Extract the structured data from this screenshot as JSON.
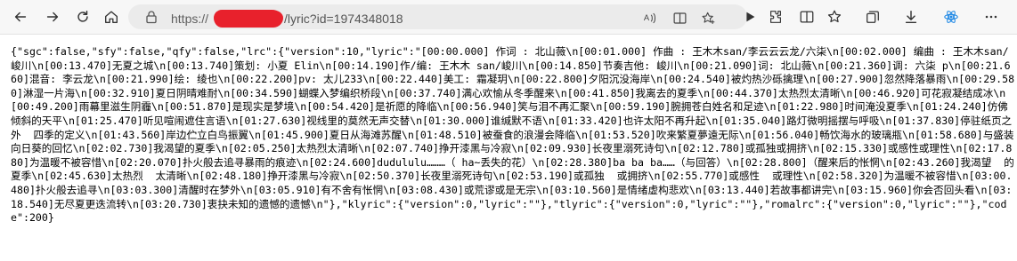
{
  "browser": {
    "url_prefix": "https://",
    "url_suffix": "/lyric?id=1974348018",
    "icons": [
      "back-icon",
      "forward-icon",
      "refresh-icon",
      "home-icon",
      "lock-icon",
      "read-aloud-icon",
      "split-screen-icon",
      "add-favorite-icon",
      "extension-icon",
      "play-icon",
      "split-icon",
      "favorites-icon",
      "collections-icon",
      "downloads-icon",
      "react-devtools-icon"
    ]
  },
  "page": {
    "json_text": "{\"sgc\":false,\"sfy\":false,\"qfy\":false,\"lrc\":{\"version\":10,\"lyric\":\"[00:00.000] 作词 : 北山薇\\n[00:01.000] 作曲 : 王木木san/李云云云龙/六柒\\n[00:02.000] 编曲 : 王木木san/峻川\\n[00:13.470]无夏之城\\n[00:13.740]策划: 小夏 Elin\\n[00:14.190]作/编: 王木木 san/峻川\\n[00:14.850]节奏吉他: 峻川\\n[00:21.090]词: 北山薇\\n[00:21.360]调: 六柒 p\\n[00:21.660]混音: 李云龙\\n[00:21.990]绘: 绫也\\n[00:22.200]pv: 太儿233\\n[00:22.440]美工: 霜凝玥\\n[00:22.800]夕阳沉没海岸\\n[00:24.540]被灼热沙砾擒理\\n[00:27.900]忽然降落暴雨\\n[00:29.580]淋湿一片海\\n[00:32.910]夏日阴晴难耐\\n[00:34.590]蝴蝶入梦编织桥段\\n[00:37.740]满心欢愉从冬季醒来\\n[00:41.850]我离去的夏季\\n[00:44.370]太热烈太清晰\\n[00:46.920]可花寂凝结成冰\\n[00:49.200]雨幕里滋生阴霾\\n[00:51.870]是现实是梦境\\n[00:54.420]是祈愿的降临\\n[00:56.940]笑与泪不再汇聚\\n[00:59.190]腕拥苍白姓名和足迹\\n[01:22.980]时间淹没夏季\\n[01:24.240]仿佛倾斜的天平\\n[01:25.470]听见喧闹遮住言语\\n[01:27.630]视线里的莫然无声交替\\n[01:30.000]谁缄默不语\\n[01:33.420]也许太阳不再升起\\n[01:35.040]路灯微明摇摆与呼吸\\n[01:37.830]停驻纸页之外  四季的定义\\n[01:43.560]岸边伫立白鸟振翼\\n[01:45.900]夏日从海滩苏醒\\n[01:48.510]被蚕食的浪漫会降临\\n[01:53.520]吹来繁夏夢遠无际\\n[01:56.040]畅饮海水的玻璃瓶\\n[01:58.680]与盛装向日葵的回忆\\n[02:02.730]我渴望的夏季\\n[02:05.250]太热烈太清晰\\n[02:07.740]挣开漆黑与冷寂\\n[02:09.930]长夜里溺死诗句\\n[02:12.780]或孤独或拥挤\\n[02:15.330]或感性或理性\\n[02:17.880]为温暖不被容惜\\n[02:20.070]扑火般去追寻暴雨的痕迹\\n[02:24.600]dudululu………（ ha~丢失的花）\\n[02:28.380]ba ba ba……（与回答）\\n[02:28.800]（醒来后的怅惘\\n[02:43.260]我渴望  的夏季\\n[02:45.630]太热烈  太清晰\\n[02:48.180]挣开漆黑与冷寂\\n[02:50.370]长夜里溺死诗句\\n[02:53.190]或孤独  或拥挤\\n[02:55.770]或感性  或理性\\n[02:58.320]为温暖不被容惜\\n[03:00.480]扑火般去追寻\\n[03:03.300]清醒时在梦外\\n[03:05.910]有不舍有怅惘\\n[03:08.430]或荒谬或是无宗\\n[03:10.560]是情绪虚构悲欢\\n[03:13.440]若故事都讲完\\n[03:15.960]你会否回头看\\n[03:18.540]无尽夏更迭流转\\n[03:20.730]衷抉未知的遗憾的遗憾\\n\"},\"klyric\":{\"version\":0,\"lyric\":\"\"},\"tlyric\":{\"version\":0,\"lyric\":\"\"},\"romalrc\":{\"version\":0,\"lyric\":\"\"},\"code\":200}"
  }
}
